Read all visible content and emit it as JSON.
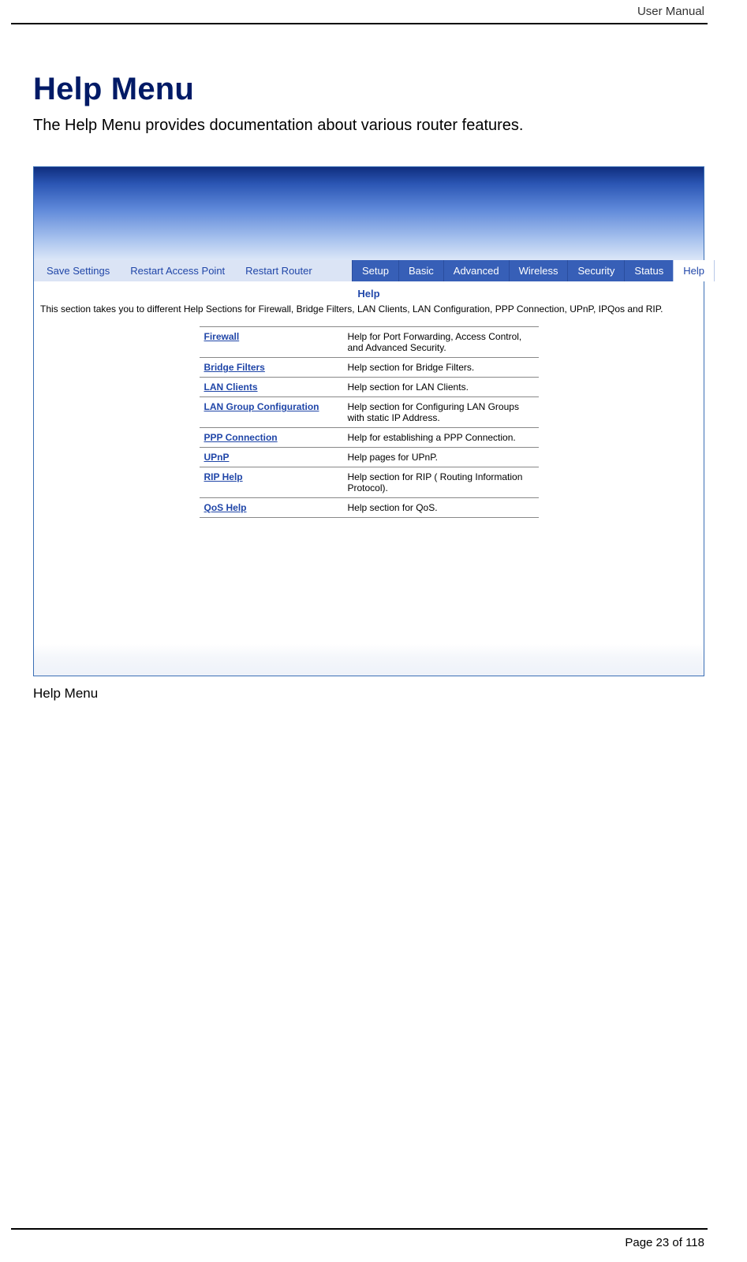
{
  "doc": {
    "header_label": "User Manual",
    "page_number_text": "Page 23 of 118"
  },
  "page": {
    "title": "Help Menu",
    "intro": "The Help Menu provides documentation about various router features.",
    "caption": "Help Menu"
  },
  "router_ui": {
    "left_actions": {
      "save": "Save Settings",
      "restart_ap": "Restart Access Point",
      "restart_router": "Restart Router"
    },
    "tabs": {
      "setup": "Setup",
      "basic": "Basic",
      "advanced": "Advanced",
      "wireless": "Wireless",
      "security": "Security",
      "status": "Status",
      "help": "Help"
    },
    "help_section": {
      "title": "Help",
      "description": "This section takes you to different Help Sections for Firewall, Bridge Filters, LAN Clients, LAN Configuration, PPP Connection, UPnP, IPQos and RIP.",
      "rows": [
        {
          "label": "Firewall",
          "desc": "Help for Port Forwarding, Access Control, and Advanced Security."
        },
        {
          "label": "Bridge Filters",
          "desc": "Help section for Bridge Filters."
        },
        {
          "label": "LAN Clients",
          "desc": "Help section for LAN Clients."
        },
        {
          "label": "LAN Group Configuration",
          "desc": "Help section for Configuring LAN Groups with static IP Address."
        },
        {
          "label": "PPP Connection",
          "desc": "Help for establishing a PPP Connection."
        },
        {
          "label": "UPnP",
          "desc": "Help pages for UPnP."
        },
        {
          "label": "RIP Help",
          "desc": "Help section for RIP ( Routing Information Protocol)."
        },
        {
          "label": "QoS Help",
          "desc": "Help section for QoS."
        }
      ]
    }
  }
}
